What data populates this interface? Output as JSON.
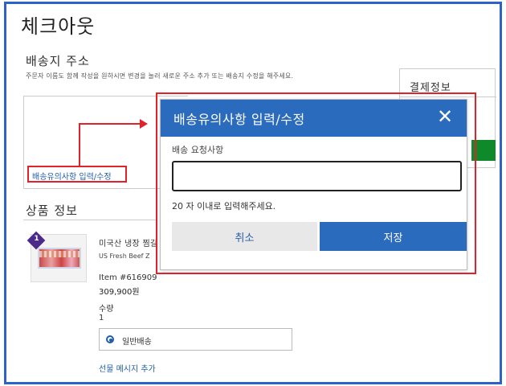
{
  "page": {
    "title": "체크아웃"
  },
  "shipping_address": {
    "title": "배송지 주소",
    "description": "주문자 이름도 함께 작성을 원하시면 변경을 눌러 새로운 주소 추가 또는 배송지 수정을 해주세요.",
    "delivery_notes_link": "배송유의사항 입력/수정"
  },
  "payment": {
    "title": "결제정보"
  },
  "product_info": {
    "title": "상품 정보",
    "badge": "1",
    "name": "미국산 냉장 찜갈",
    "name_en": "US Fresh Beef Z",
    "item_number": "Item #616909",
    "price": "309,900원",
    "quantity_label": "수량",
    "quantity_value": "1",
    "shipping_option": "일반배송",
    "gift_message_link": "선물 메시지 추가"
  },
  "modal": {
    "title": "배송유의사항 입력/수정",
    "close_icon": "close-icon",
    "field_label": "배송 요청사항",
    "field_value": "",
    "hint": "20 자 이내로 입력해주세요.",
    "cancel_label": "취소",
    "save_label": "저장"
  },
  "colors": {
    "accent": "#2a6bbd",
    "highlight": "#e0222b",
    "link": "#1f5ea8",
    "frame": "#2d63c8"
  }
}
